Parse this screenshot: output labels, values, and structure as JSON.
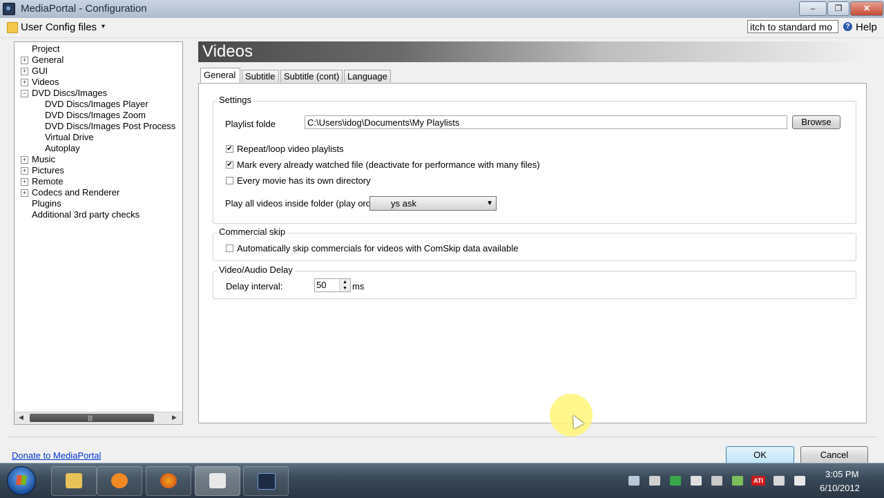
{
  "window": {
    "title": "MediaPortal - Configuration",
    "minimize_glyph": "–",
    "maximize_glyph": "❐",
    "close_glyph": "✕"
  },
  "menubar": {
    "config_label": "User Config files",
    "config_caret": "▾",
    "switch_value": "itch to standard mo",
    "help_glyph": "?",
    "help_label": "Help"
  },
  "tree": {
    "items": [
      {
        "label": "Project",
        "expander": ""
      },
      {
        "label": "General",
        "expander": "+"
      },
      {
        "label": "GUI",
        "expander": "+"
      },
      {
        "label": "Videos",
        "expander": "+"
      },
      {
        "label": "DVD Discs/Images",
        "expander": "−"
      },
      {
        "label": "DVD Discs/Images Player",
        "expander": ""
      },
      {
        "label": "DVD Discs/Images Zoom",
        "expander": ""
      },
      {
        "label": "DVD Discs/Images Post Process",
        "expander": ""
      },
      {
        "label": "Virtual Drive",
        "expander": ""
      },
      {
        "label": "Autoplay",
        "expander": ""
      },
      {
        "label": "Music",
        "expander": "+"
      },
      {
        "label": "Pictures",
        "expander": "+"
      },
      {
        "label": "Remote",
        "expander": "+"
      },
      {
        "label": "Codecs and Renderer",
        "expander": "+"
      },
      {
        "label": "Plugins",
        "expander": ""
      },
      {
        "label": "Additional 3rd party checks",
        "expander": ""
      }
    ],
    "scroll_left": "◀",
    "scroll_right": "▶",
    "scroll_grip": "|||"
  },
  "main": {
    "section_title": "Videos",
    "tabs": [
      {
        "label": "General"
      },
      {
        "label": "Subtitle"
      },
      {
        "label": "Subtitle (cont)"
      },
      {
        "label": "Language"
      }
    ],
    "settings": {
      "group_title": "Settings",
      "playlist_label": "Playlist folde",
      "playlist_value": "C:\\Users\\idog\\Documents\\My Playlists",
      "browse_label": "Browse",
      "checks": [
        {
          "label": "Repeat/loop video playlists",
          "mark": "✔"
        },
        {
          "label": "Mark every already watched file (deactivate for performance with many files)",
          "mark": "✔"
        },
        {
          "label": "Every movie has its own directory",
          "mark": ""
        }
      ],
      "play_all_label": "Play all videos inside folder (play order):",
      "play_all_value": "ys ask",
      "dropdown_caret": "▼"
    },
    "commercial": {
      "group_title": "Commercial skip",
      "check_label": "Automatically skip commercials for videos with ComSkip data available",
      "mark": ""
    },
    "delay": {
      "group_title": "Video/Audio Delay",
      "interval_label": "Delay interval:",
      "interval_value": "50",
      "unit": "ms",
      "spin_up": "▲",
      "spin_down": "▼"
    }
  },
  "footer": {
    "donate_label": "Donate to MediaPortal",
    "ok_label": "OK",
    "cancel_label": "Cancel"
  },
  "taskbar": {
    "time": "3:05 PM",
    "date": "6/10/2012",
    "tray_badge": "ATI"
  }
}
